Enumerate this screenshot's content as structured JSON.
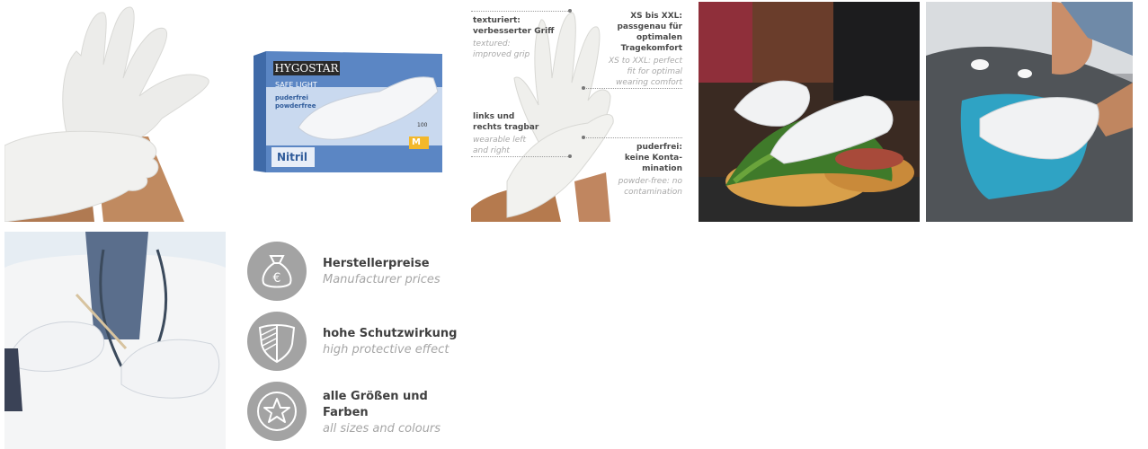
{
  "box": {
    "brand": "HYGOSTAR",
    "product_line": "SAFE LIGHT",
    "desc_de": "puderfrei",
    "desc_en": "powderfree",
    "count": "100",
    "size": "M",
    "material": "Nitril"
  },
  "annotations": [
    {
      "de": "texturiert:\nverbesserter Griff",
      "en": "textured:\nimproved grip"
    },
    {
      "de": "XS bis XXL:\npassgenau für\noptimalen\nTragekomfort",
      "en": "XS to XXL: perfect\nfit for optimal\nwearing comfort"
    },
    {
      "de": "links und\nrechts tragbar",
      "en": "wearable left\nand right"
    },
    {
      "de": "puderfrei:\nkeine Konta-\nmination",
      "en": "powder-free: no\ncontamination"
    }
  ],
  "features": [
    {
      "icon": "money-bag-euro-icon",
      "de": "Herstellerpreise",
      "en": "Manufacturer prices"
    },
    {
      "icon": "shield-icon",
      "de": "hohe Schutzwirkung",
      "en": "high protective effect"
    },
    {
      "icon": "star-icon",
      "de": "alle Größen und Farben",
      "en": "all sizes and colours"
    }
  ],
  "colors": {
    "badge": "#a3a3a3",
    "box_blue": "#5b86c4",
    "cloth": "#2fa3c4",
    "title_text": "#3f3f3f",
    "subtitle_text": "#a6a6a6"
  }
}
